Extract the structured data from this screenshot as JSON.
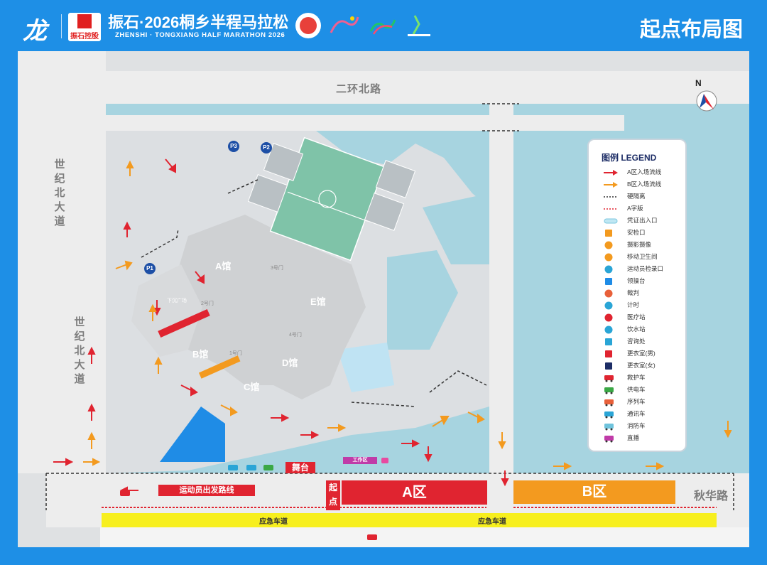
{
  "header": {
    "event_title": "振石·2026桐乡半程马拉松",
    "event_subtitle": "ZHENSHI · TONGXIANG HALF MARATHON 2026",
    "page_title": "起点布局图",
    "sponsor_name": "振石控股",
    "colors": {
      "background": "#1e8fe6",
      "text": "#ffffff"
    }
  },
  "map": {
    "roads": {
      "north": "二环北路",
      "west": "世纪北大道",
      "south": "秋华路"
    },
    "north_label": "N",
    "halls": [
      "A馆",
      "B馆",
      "C馆",
      "D馆",
      "E馆"
    ],
    "gates": [
      "3号门",
      "2号门",
      "1号门",
      "4号门"
    ],
    "plaza": "下沉广场",
    "parking": [
      "P1",
      "P2",
      "P3"
    ],
    "zones": {
      "a": "A区",
      "b": "B区",
      "start_line": "起点",
      "stage": "舞台",
      "work_area": "工作区"
    },
    "route_label": "运动员出发路线",
    "emergency_lane": "应急车道",
    "colors": {
      "zone_a": "#e02430",
      "zone_b": "#f39a1f",
      "emergency_lane": "#f7ef1e",
      "water": "#a7d4e0",
      "venue": "#dfe1e3"
    }
  },
  "legend": {
    "title": "图例 LEGEND",
    "items": [
      {
        "label": "A区入场流线",
        "icon": "red-arrow"
      },
      {
        "label": "B区入场流线",
        "icon": "orange-arrow"
      },
      {
        "label": "硬隔离",
        "icon": "dashed-line"
      },
      {
        "label": "A字版",
        "icon": "red-dashed-line"
      },
      {
        "label": "凭证出入口",
        "icon": "entry-gate"
      },
      {
        "label": "安检口",
        "icon": "security-check-icon"
      },
      {
        "label": "摄影摄像",
        "icon": "camera-icon"
      },
      {
        "label": "移动卫生间",
        "icon": "toilet-icon"
      },
      {
        "label": "运动员检录口",
        "icon": "check-in-icon"
      },
      {
        "label": "领操台",
        "icon": "platform-icon"
      },
      {
        "label": "裁判",
        "icon": "referee-icon"
      },
      {
        "label": "计时",
        "icon": "timer-icon"
      },
      {
        "label": "医疗站",
        "icon": "medical-icon"
      },
      {
        "label": "饮水站",
        "icon": "water-icon"
      },
      {
        "label": "咨询处",
        "icon": "info-icon"
      },
      {
        "label": "更衣室(男)",
        "icon": "changing-room-male-icon"
      },
      {
        "label": "更衣室(女)",
        "icon": "changing-room-female-icon"
      },
      {
        "label": "救护车",
        "icon": "ambulance-icon"
      },
      {
        "label": "供电车",
        "icon": "power-truck-icon"
      },
      {
        "label": "序列车",
        "icon": "sequence-car-icon"
      },
      {
        "label": "通讯车",
        "icon": "comms-truck-icon"
      },
      {
        "label": "消防车",
        "icon": "fire-truck-icon"
      },
      {
        "label": "直播",
        "icon": "live-stream-icon"
      }
    ]
  }
}
